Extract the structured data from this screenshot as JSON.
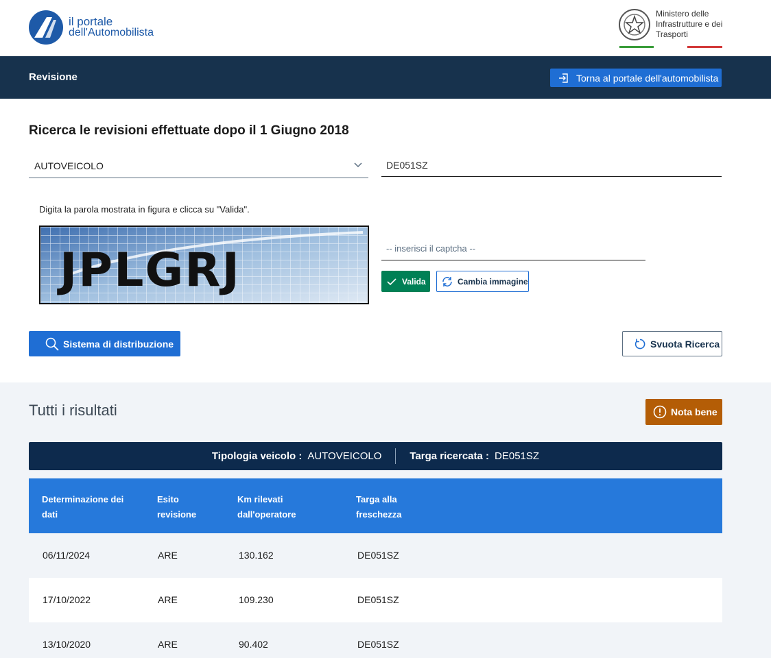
{
  "header": {
    "logo_line1": "il portale",
    "logo_line2": "dell'Automobilista",
    "ministry_line1": "Ministero delle",
    "ministry_line2": "Infrastrutture e dei",
    "ministry_line3": "Trasporti"
  },
  "navbar": {
    "title": "Revisione",
    "back_button": "Torna al portale dell'automobilista"
  },
  "search": {
    "title": "Ricerca le revisioni effettuate dopo il 1 Giugno 2018",
    "vehicle_type": "AUTOVEICOLO",
    "plate_value": "DE051SZ",
    "captcha_hint": "Digita la parola mostrata in figura e clicca su \"Valida\".",
    "captcha_text": "JPLGRJ",
    "captcha_placeholder": "-- inserisci il captcha --",
    "valida_label": "Valida",
    "cambia_label": "Cambia immagine",
    "sistema_label": "Sistema di distribuzione",
    "svuota_label": "Svuota Ricerca"
  },
  "results": {
    "title": "Tutti i risultati",
    "nota_label": "Nota bene",
    "summary": {
      "type_label": "Tipologia veicolo :",
      "type_value": "AUTOVEICOLO",
      "plate_label": "Targa ricercata :",
      "plate_value": "DE051SZ"
    },
    "columns": [
      {
        "line1": "Determinazione dei",
        "line2": "dati"
      },
      {
        "line1": "Esito",
        "line2": "revisione"
      },
      {
        "line1": "Km rilevati",
        "line2": "dall'operatore"
      },
      {
        "line1": "Targa alla",
        "line2": "freschezza"
      }
    ],
    "rows": [
      {
        "date": "06/11/2024",
        "esito": "ARE",
        "km": "130.162",
        "targa": "DE051SZ"
      },
      {
        "date": "17/10/2022",
        "esito": "ARE",
        "km": "109.230",
        "targa": "DE051SZ"
      },
      {
        "date": "13/10/2020",
        "esito": "ARE",
        "km": "90.402",
        "targa": "DE051SZ"
      }
    ]
  },
  "colors": {
    "navbar": "#17324d",
    "primary": "#1f6ed4",
    "success": "#008055",
    "warning": "#b45d06",
    "table_header": "#2679db"
  }
}
